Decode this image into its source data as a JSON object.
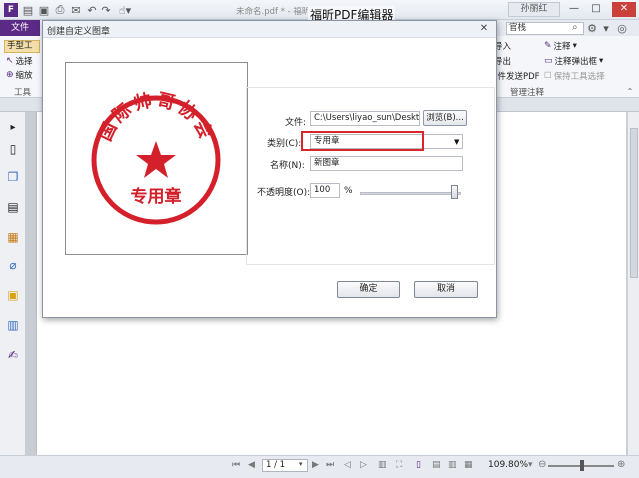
{
  "window": {
    "title": "未命名.pdf * - 福昕高级PDF编辑器",
    "overlay_title": "福昕PDF编辑器",
    "login_label": "孙丽红",
    "controls": {
      "minimize": "—",
      "maximize": "□",
      "close": "✕"
    }
  },
  "quick_access": [
    "open-icon",
    "save-icon",
    "print-icon",
    "undo-icon",
    "redo-icon",
    "hand-icon"
  ],
  "ribbon": {
    "file_tab": "文件",
    "search_value": "官栈",
    "left": {
      "hand_tool": "手型工",
      "select_tool": "选择",
      "zoom_tool": "缩放",
      "group_label": "工具"
    },
    "right": {
      "import_label": "导入",
      "export_label": "导出",
      "email_label": "邮件发送PDF",
      "annotate_label": "注释",
      "popup_label": "注释弹出框",
      "keep_tool_label": "保持工具选择",
      "group_label": "管理注释"
    }
  },
  "dialog": {
    "title": "创建自定义图章",
    "close": "✕",
    "stamp_preview": {
      "top_text": "国际帅哥协会",
      "bottom_text": "专用章",
      "color": "#d4202a"
    },
    "file_label": "文件:",
    "file_value": "C:\\Users\\liyao_sun\\Desktop\\",
    "browse_label": "浏览(B)...",
    "category_label": "类别(C):",
    "category_value": "专用章",
    "name_label": "名称(N):",
    "name_value": "新图章",
    "opacity_label": "不透明度(O):",
    "opacity_value": "100",
    "opacity_unit": "%",
    "opacity_level": 1.0,
    "ok_label": "确定",
    "cancel_label": "取消"
  },
  "status": {
    "page_value": "1 / 1",
    "zoom_value": "109.80%",
    "zoom_minus": "⊖",
    "zoom_plus": "⊕"
  },
  "colors": {
    "accent": "#5b2a86",
    "highlight": "#d9262b",
    "stamp": "#d4202a"
  }
}
